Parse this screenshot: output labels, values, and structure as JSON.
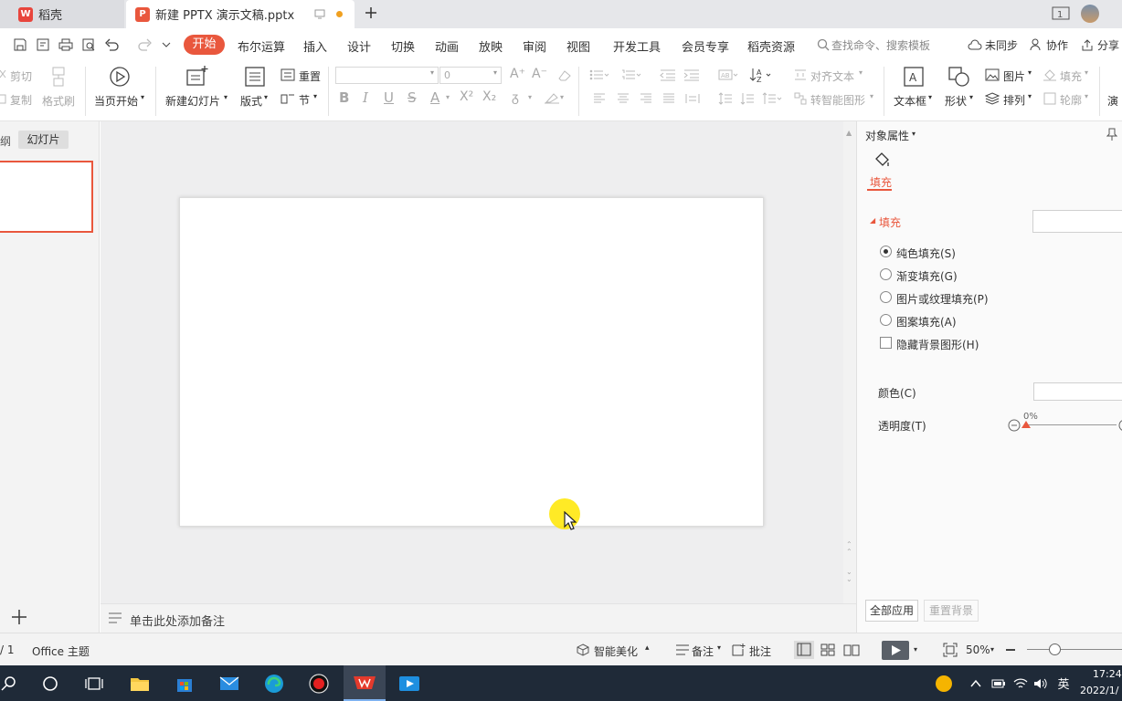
{
  "tabs": [
    {
      "label": "稻壳",
      "active": false
    },
    {
      "label": "新建 PPTX 演示文稿.pptx",
      "active": true
    }
  ],
  "menu": [
    "开始",
    "布尔运算",
    "插入",
    "设计",
    "切换",
    "动画",
    "放映",
    "审阅",
    "视图",
    "开发工具",
    "会员专享",
    "稻壳资源"
  ],
  "search_placeholder": "查找命令、搜索模板",
  "right_actions": {
    "sync": "未同步",
    "collab": "协作",
    "share": "分享"
  },
  "ribbon": {
    "cut": "剪切",
    "copy": "复制",
    "format_painter": "格式刷",
    "from_current": "当页开始",
    "new_slide": "新建幻灯片",
    "layout": "版式",
    "reset": "重置",
    "section": "节",
    "font_size": "0",
    "align_text": "对齐文本",
    "smartart": "转智能图形",
    "textbox": "文本框",
    "shape": "形状",
    "picture": "图片",
    "arrange": "排列",
    "fill": "填充",
    "outline": "轮廓",
    "more": "演"
  },
  "left_panel": {
    "tab_outline": "纲",
    "tab_slides": "幻灯片"
  },
  "notes_placeholder": "单击此处添加备注",
  "right_panel": {
    "title": "对象属性",
    "fill_tab": "填充",
    "section_fill": "填充",
    "options": [
      {
        "label": "纯色填充(S)",
        "selected": true
      },
      {
        "label": "渐变填充(G)",
        "selected": false
      },
      {
        "label": "图片或纹理填充(P)",
        "selected": false
      },
      {
        "label": "图案填充(A)",
        "selected": false
      }
    ],
    "hide_bg": "隐藏背景图形(H)",
    "color_label": "颜色(C)",
    "transparency_label": "透明度(T)",
    "transparency_value": "0%",
    "apply_all": "全部应用",
    "reset_bg": "重置背景"
  },
  "status": {
    "page": "/ 1",
    "theme": "Office 主题",
    "beautify": "智能美化",
    "notes": "备注",
    "comment": "批注",
    "zoom": "50%"
  },
  "taskbar": {
    "time": "17:24",
    "date": "2022/1/",
    "ime": "英"
  }
}
